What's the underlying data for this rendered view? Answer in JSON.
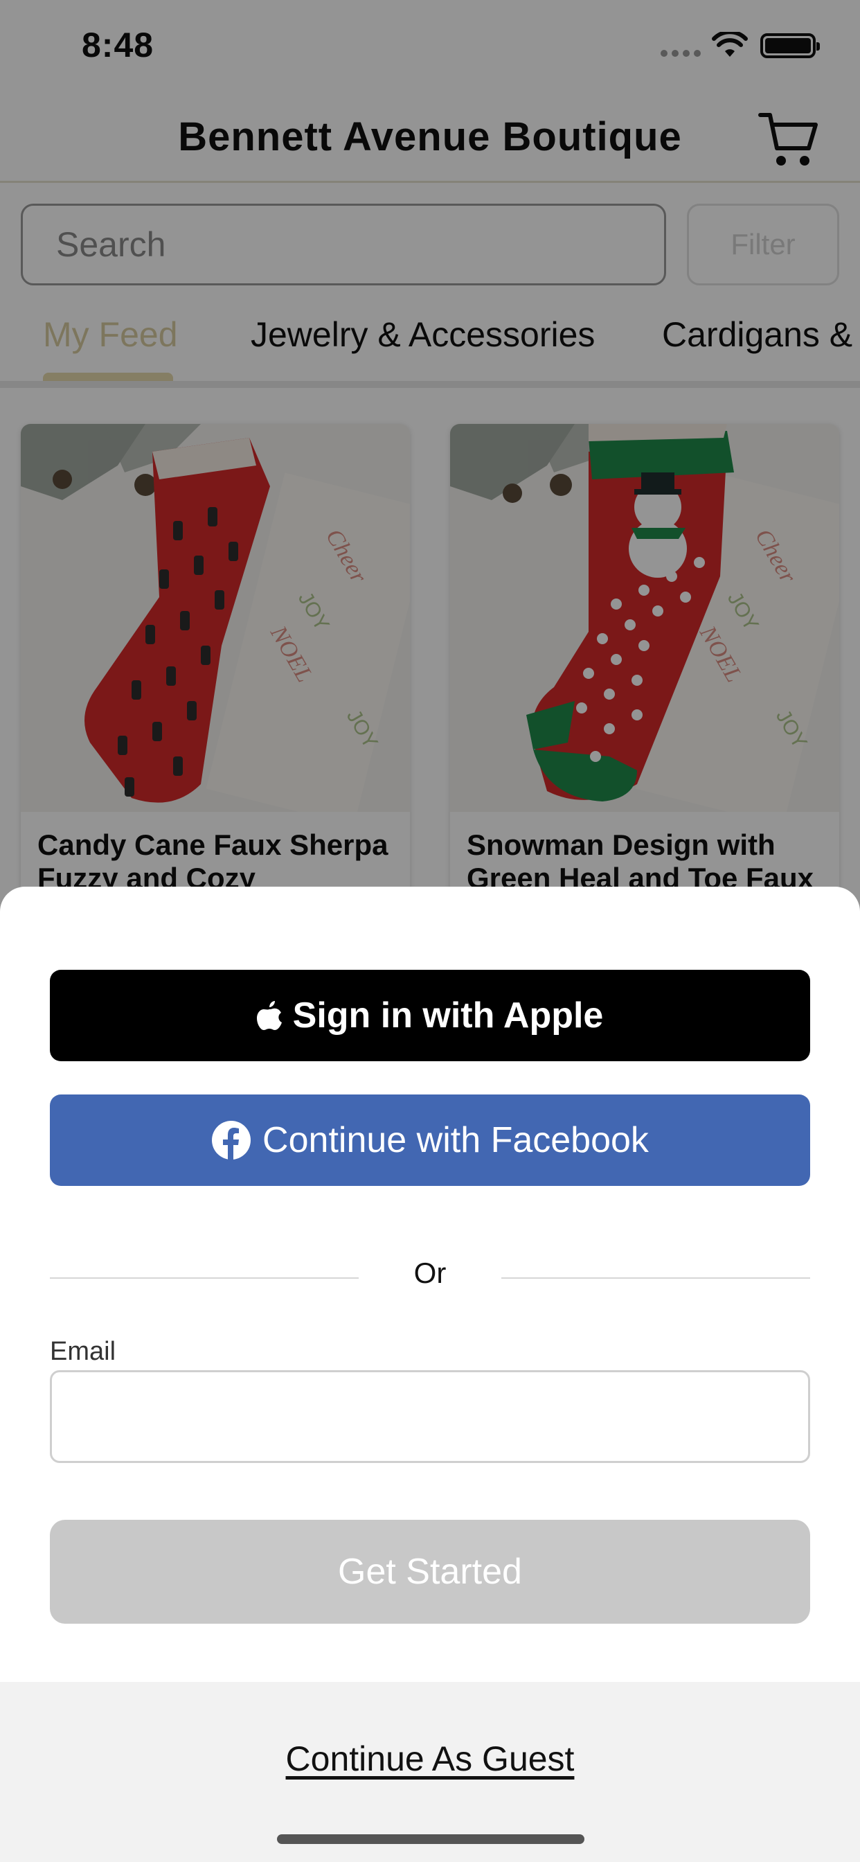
{
  "status_bar": {
    "time": "8:48"
  },
  "header": {
    "title": "Bennett Avenue Boutique"
  },
  "search": {
    "placeholder": "Search",
    "filter_label": "Filter"
  },
  "tabs": [
    {
      "label": "My Feed",
      "active": true
    },
    {
      "label": "Jewelry & Accessories",
      "active": false
    },
    {
      "label": "Cardigans & K",
      "active": false
    }
  ],
  "products": [
    {
      "name": "Candy Cane Faux Sherpa Fuzzy and Cozy Christmas"
    },
    {
      "name": "Snowman Design with Green Heal and Toe Faux"
    }
  ],
  "sheet": {
    "apple_label": "Sign in with Apple",
    "facebook_label": "Continue with Facebook",
    "or_label": "Or",
    "email_label": "Email",
    "email_value": "",
    "get_started_label": "Get Started",
    "guest_label": "Continue As Guest"
  },
  "colors": {
    "facebook_blue": "#4267b2",
    "apple_black": "#000000",
    "disabled_gray": "#c8c8c8",
    "tab_active": "#d8cca0"
  }
}
